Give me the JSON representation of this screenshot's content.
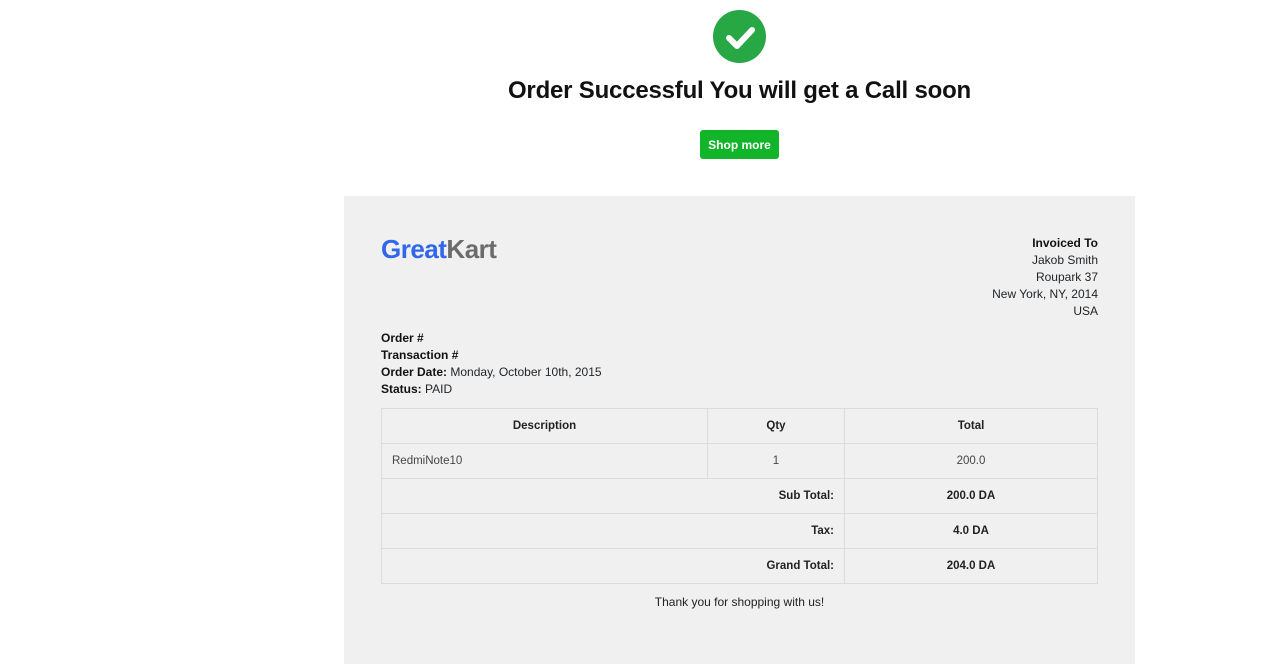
{
  "header": {
    "title": "Order Successful You will get a Call soon",
    "shop_more_label": "Shop more"
  },
  "invoice": {
    "logo": {
      "part1": "Great",
      "part2": "Kart"
    },
    "invoiced_to": {
      "label": "Invoiced To",
      "name": "Jakob Smith",
      "street": "Roupark 37",
      "city": "New York, NY, 2014",
      "country": "USA"
    },
    "order": {
      "order_label": "Order #",
      "transaction_label": "Transaction #",
      "date_label": "Order Date:",
      "date_value": "Monday, October 10th, 2015",
      "status_label": "Status:",
      "status_value": "PAID"
    },
    "table": {
      "headers": [
        "Description",
        "Qty",
        "Total"
      ],
      "rows": [
        {
          "description": "RedmiNote10",
          "qty": "1",
          "total": "200.0"
        }
      ],
      "subtotal_label": "Sub Total:",
      "subtotal_value": "200.0 DA",
      "tax_label": "Tax:",
      "tax_value": "4.0 DA",
      "grand_label": "Grand Total:",
      "grand_value": "204.0 DA"
    },
    "thanks": "Thank you for shopping with us!"
  },
  "colors": {
    "success_green": "#28a745",
    "button_green": "#12b52a",
    "logo_blue": "#3167eb",
    "logo_gray": "#6c6c6c",
    "panel_bg": "#f0f0f0"
  },
  "icons": {
    "success": "check-circle-icon"
  }
}
